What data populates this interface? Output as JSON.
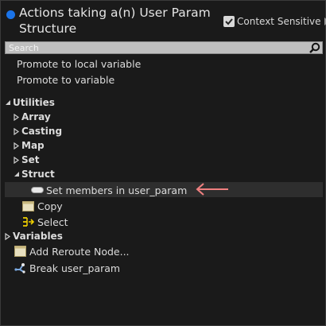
{
  "header": {
    "title": "Actions taking a(n) User Param Structure",
    "context_sensitive_label": "Context Sensitive",
    "context_sensitive_checked": true,
    "accent_color": "#1a73e8"
  },
  "search": {
    "placeholder": "Search",
    "value": ""
  },
  "top_actions": [
    {
      "label": "Promote to local variable"
    },
    {
      "label": "Promote to variable"
    }
  ],
  "tree": {
    "utilities": {
      "label": "Utilities",
      "expanded": true
    },
    "array": {
      "label": "Array",
      "expanded": false
    },
    "casting": {
      "label": "Casting",
      "expanded": false
    },
    "map": {
      "label": "Map",
      "expanded": false
    },
    "set": {
      "label": "Set",
      "expanded": false
    },
    "struct": {
      "label": "Struct",
      "expanded": true
    },
    "set_members": {
      "label": "Set members in user_param",
      "icon": "struct-node-icon",
      "selected": true
    },
    "copy": {
      "label": "Copy",
      "icon": "copy-node-icon"
    },
    "select": {
      "label": "Select",
      "icon": "select-node-icon"
    },
    "variables": {
      "label": "Variables",
      "expanded": false
    },
    "add_reroute": {
      "label": "Add Reroute Node...",
      "icon": "reroute-node-icon"
    },
    "break_param": {
      "label": "Break user_param",
      "icon": "break-struct-icon"
    }
  },
  "annotation": {
    "arrow_color": "#f08080",
    "icon": "left-arrow-icon"
  }
}
